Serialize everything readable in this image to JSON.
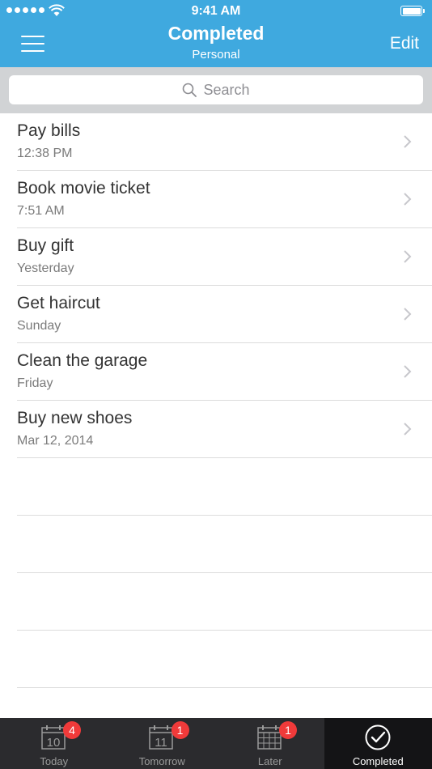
{
  "status_bar": {
    "time": "9:41 AM"
  },
  "nav": {
    "title": "Completed",
    "subtitle": "Personal",
    "edit_label": "Edit"
  },
  "search": {
    "placeholder": "Search"
  },
  "tasks": [
    {
      "title": "Pay bills",
      "time": "12:38 PM"
    },
    {
      "title": "Book movie ticket",
      "time": "7:51 AM"
    },
    {
      "title": "Buy gift",
      "time": "Yesterday"
    },
    {
      "title": "Get haircut",
      "time": "Sunday"
    },
    {
      "title": "Clean the garage",
      "time": "Friday"
    },
    {
      "title": "Buy new shoes",
      "time": "Mar 12, 2014"
    }
  ],
  "tabs": [
    {
      "label": "Today",
      "icon": "calendar-day-icon",
      "date": "10",
      "badge": "4"
    },
    {
      "label": "Tomorrow",
      "icon": "calendar-day-icon",
      "date": "11",
      "badge": "1"
    },
    {
      "label": "Later",
      "icon": "calendar-grid-icon",
      "badge": "1"
    },
    {
      "label": "Completed",
      "icon": "check-circle-icon",
      "active": true
    }
  ],
  "colors": {
    "accent": "#3fa9df",
    "badge": "#f03a3a",
    "tabbar": "#2b2b2e"
  }
}
